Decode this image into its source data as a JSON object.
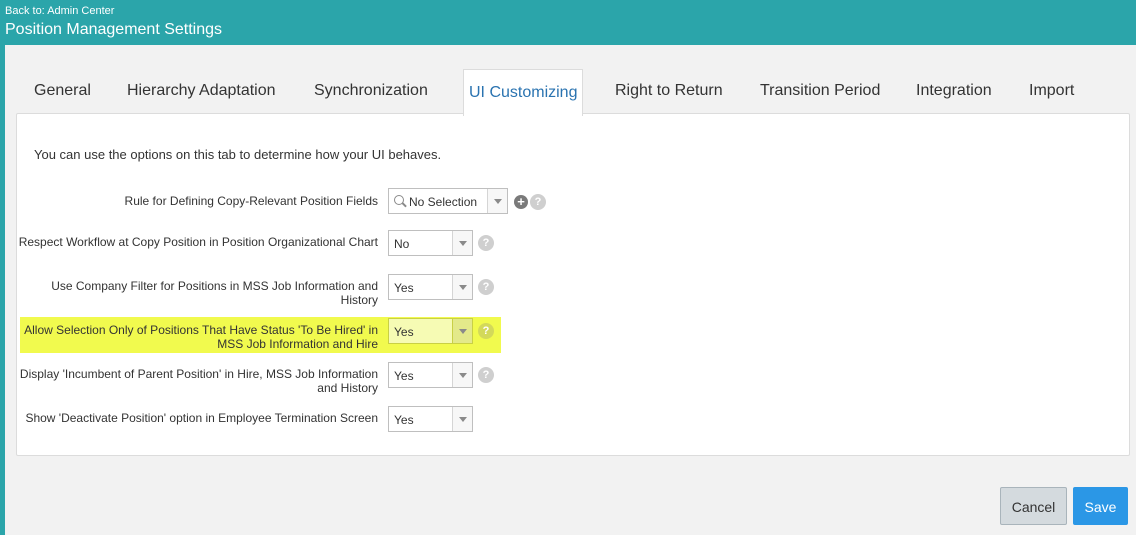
{
  "header": {
    "back_link": "Back to: Admin Center",
    "title": "Position Management Settings"
  },
  "tabs": [
    {
      "label": "General"
    },
    {
      "label": "Hierarchy Adaptation"
    },
    {
      "label": "Synchronization"
    },
    {
      "label": "UI Customizing",
      "active": true
    },
    {
      "label": "Right to Return"
    },
    {
      "label": "Transition Period"
    },
    {
      "label": "Integration"
    },
    {
      "label": "Import"
    }
  ],
  "panel": {
    "intro": "You can use the options on this tab to determine how your UI behaves.",
    "settings": [
      {
        "label": "Rule for Defining Copy-Relevant Position Fields",
        "value": "No Selection"
      },
      {
        "label": "Respect Workflow at Copy Position in Position Organizational Chart",
        "value": "No"
      },
      {
        "label": "Use Company Filter for Positions in MSS Job Information and History",
        "value": "Yes"
      },
      {
        "label": "Allow Selection Only of Positions That Have Status 'To Be Hired' in MSS Job Information and Hire",
        "value": "Yes",
        "highlighted": true
      },
      {
        "label": "Display 'Incumbent of Parent Position' in Hire, MSS Job Information and History",
        "value": "Yes"
      },
      {
        "label": "Show 'Deactivate Position' option in Employee Termination Screen",
        "value": "Yes"
      }
    ],
    "help_glyph": "?",
    "add_glyph": "+"
  },
  "footer": {
    "cancel_label": "Cancel",
    "save_label": "Save"
  },
  "colors": {
    "header": "#2ba5aa",
    "active_tab_text": "#2a73b0",
    "highlight": "#f1fa4e",
    "save_button": "#2b97e6"
  }
}
